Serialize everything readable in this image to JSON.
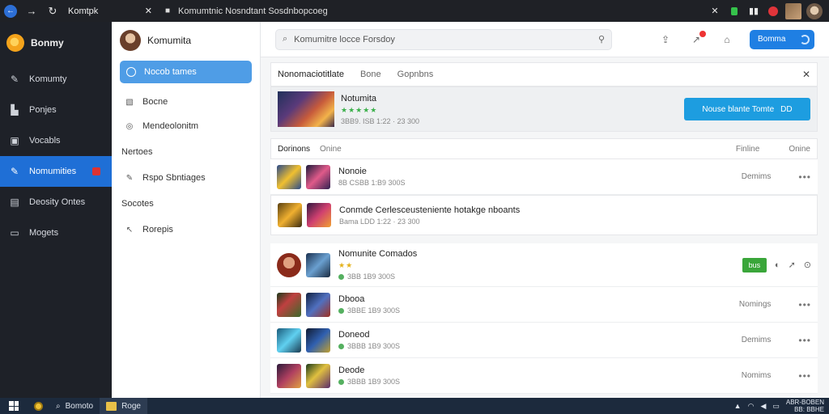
{
  "browser": {
    "tab_title": "Komtpk",
    "url": "Komumtnic Nosndtant Sosdnbopcoeg",
    "colors": {
      "bar": "#1f2126",
      "back": "#2d6fd6"
    }
  },
  "leftnav": {
    "brand": "Bonmy",
    "items": [
      {
        "label": "Komumty",
        "icon": "pen-icon"
      },
      {
        "label": "Ponjes",
        "icon": "building-icon"
      },
      {
        "label": "Vocabls",
        "icon": "box-icon"
      },
      {
        "label": "Nomumities",
        "icon": "pen-icon",
        "active": true
      },
      {
        "label": "Deosity Ontes",
        "icon": "page-icon"
      },
      {
        "label": "Mogets",
        "icon": "device-icon"
      }
    ],
    "accent": "#1f6fd6"
  },
  "subnav": {
    "user": "Komumita",
    "primary": "Nocob tames",
    "items": [
      {
        "label": "Bocne",
        "icon": "image-icon"
      },
      {
        "label": "Mendeolonitm",
        "icon": "clock-icon"
      }
    ],
    "section1": "Nertoes",
    "section1_items": [
      {
        "label": "Rspo Sbntiages",
        "icon": "pencil-icon"
      }
    ],
    "section2": "Socotes",
    "section2_items": [
      {
        "label": "Rorepis",
        "icon": "reply-icon"
      }
    ]
  },
  "topbar": {
    "search_value": "Komumitre locce Forsdoy",
    "cta_label": "Bomma"
  },
  "tabs": [
    "Nonomaciotitlate",
    "Bone",
    "Gopnbns"
  ],
  "featured": {
    "title": "Notumita",
    "stars": "★★★★★",
    "meta": "3BB9. ISB 1:22 · 23 300",
    "cta_label": "Nouse blante Tomte",
    "cta_badge": "DD"
  },
  "list_header": {
    "left": "Dorinons",
    "left2": "Onine",
    "right1": "Finline",
    "right2": "Onine"
  },
  "rows": [
    {
      "title": "Nonoie",
      "meta": "8B CSBB 1:B9 300S",
      "status": "Demims"
    },
    {
      "title": "Conmde Cerlesceusteniente hotakge nboants",
      "meta": "Bama LDD 1:22 · 23 300",
      "status": ""
    },
    {
      "title": "Nomunite Comados",
      "stars": "★★",
      "meta": "3BB 1B9 300S",
      "buy": "bus"
    },
    {
      "title": "Dbooa",
      "meta": "3BBE 1B9 300S",
      "status": "Nomings"
    },
    {
      "title": "Doneod",
      "meta": "3BBB 1B9 300S",
      "status": "Demims"
    },
    {
      "title": "Deode",
      "meta": "3BBB 1B9 300S",
      "status": "Nomims"
    }
  ],
  "taskbar": {
    "search": "Bomoto",
    "app": "Roge",
    "time": "ABR-BOBEN",
    "date": "BB: BBHE"
  }
}
